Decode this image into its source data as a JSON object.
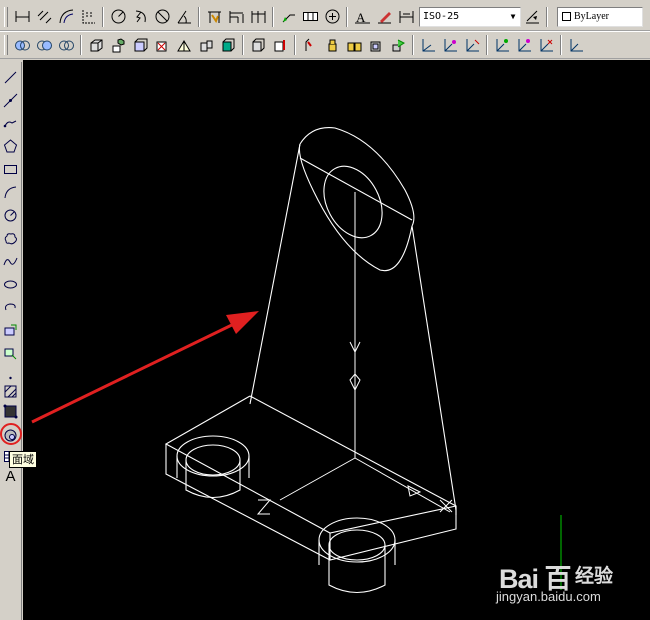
{
  "toolbar_top": {
    "tools_group1": [
      "linear-dimension-icon",
      "aligned-dimension-icon",
      "arc-length-icon",
      "ordinate-icon"
    ],
    "tools_group2": [
      "radius-icon",
      "jogged-icon",
      "diameter-icon",
      "angular-icon"
    ],
    "tools_group3": [
      "quick-dimension-icon",
      "baseline-icon",
      "continue-icon"
    ],
    "tools_group4": [
      "quick-leader-icon",
      "tolerance-icon",
      "center-mark-icon"
    ],
    "tools_group5": [
      "dimension-edit-icon",
      "dimension-text-edit-icon",
      "dimension-update-icon"
    ],
    "dim_style_combo": {
      "value": "ISO-25"
    },
    "layer_combo": {
      "value": "ByLayer"
    }
  },
  "toolbar_bottom": {
    "groups": [
      [
        "ucs-icon",
        "ucs-world-icon"
      ],
      [
        "box-icon",
        "sphere-icon",
        "cylinder-icon",
        "cone-icon",
        "wedge-icon",
        "torus-icon",
        "extrude-icon",
        "revolve-icon"
      ],
      [
        "slice-icon",
        "section-icon"
      ],
      [
        "union-icon",
        "subtract-icon",
        "intersect-icon"
      ],
      [
        "shell-icon",
        "separate-icon"
      ]
    ],
    "ucs_tools": [
      "ucs-origin-icon",
      "ucs-3point-icon",
      "ucs-object-icon",
      "ucs-face-icon",
      "ucs-view-icon",
      "ucs-x-icon"
    ]
  },
  "draw_toolbar": {
    "items": [
      "line-icon",
      "construction-line-icon",
      "polyline-icon",
      "polygon-icon",
      "rectangle-icon",
      "arc-icon",
      "circle-icon",
      "revision-cloud-icon",
      "spline-icon",
      "ellipse-icon",
      "ellipse-arc-icon",
      "insert-block-icon",
      "make-block-icon",
      "point-icon",
      "hatch-icon",
      "gradient-icon",
      "region-icon",
      "table-icon"
    ],
    "text_button_label": "A"
  },
  "tooltip": {
    "text": "面域"
  },
  "canvas": {
    "background": "#000000",
    "model_color": "#ffffff",
    "ucs_labels": {
      "y": "Y",
      "z": "Z",
      "x": "X"
    }
  },
  "annotation": {
    "color": "#e02020"
  },
  "watermark": {
    "logo": "Bai 百",
    "site": "经验",
    "url": "jingyan.baidu.com"
  }
}
